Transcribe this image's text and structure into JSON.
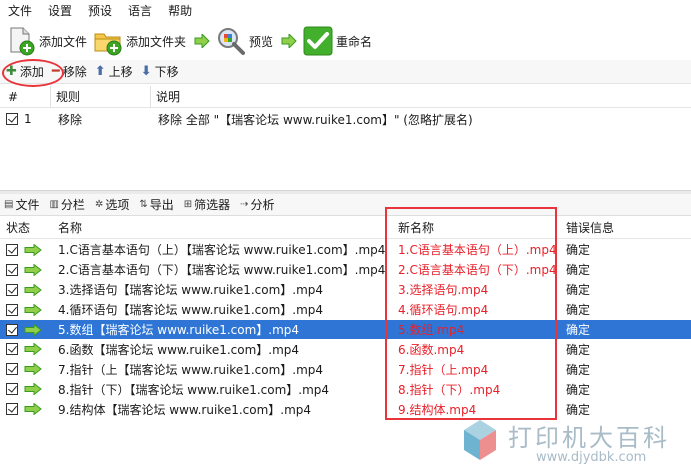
{
  "menubar": [
    "文件",
    "设置",
    "预设",
    "语言",
    "帮助"
  ],
  "toolbar": {
    "add_files": "添加文件",
    "add_folder": "添加文件夹",
    "preview": "预览",
    "rename": "重命名"
  },
  "rulebar": {
    "add": "添加",
    "remove": "移除",
    "up": "上移",
    "down": "下移"
  },
  "rule_table": {
    "headers": [
      "#",
      "规则",
      "说明"
    ],
    "rows": [
      {
        "num": "1",
        "rule": "移除",
        "desc": "移除 全部 \"【瑞客论坛 www.ruike1.com】\" (忽略扩展名)"
      }
    ]
  },
  "filebar": {
    "file": "文件",
    "columns": "分栏",
    "options": "选项",
    "export": "导出",
    "filter": "筛选器",
    "analyze": "分析"
  },
  "file_table": {
    "headers": [
      "状态",
      "名称",
      "新名称",
      "错误信息"
    ],
    "rows": [
      {
        "name": "1.C语言基本语句（上）【瑞客论坛 www.ruike1.com】.mp4",
        "new": "1.C语言基本语句（上）.mp4",
        "err": "确定"
      },
      {
        "name": "2.C语言基本语句（下）【瑞客论坛 www.ruike1.com】.mp4",
        "new": "2.C语言基本语句（下）.mp4",
        "err": "确定"
      },
      {
        "name": "3.选择语句【瑞客论坛 www.ruike1.com】.mp4",
        "new": "3.选择语句.mp4",
        "err": "确定"
      },
      {
        "name": "4.循环语句【瑞客论坛 www.ruike1.com】.mp4",
        "new": "4.循环语句.mp4",
        "err": "确定"
      },
      {
        "name": "5.数组【瑞客论坛 www.ruike1.com】.mp4",
        "new": "5.数组.mp4",
        "err": "确定"
      },
      {
        "name": "6.函数【瑞客论坛 www.ruike1.com】.mp4",
        "new": "6.函数.mp4",
        "err": "确定"
      },
      {
        "name": "7.指针（上【瑞客论坛 www.ruike1.com】.mp4",
        "new": "7.指针（上.mp4",
        "err": "确定"
      },
      {
        "name": "8.指针（下）【瑞客论坛 www.ruike1.com】.mp4",
        "new": "8.指针（下）.mp4",
        "err": "确定"
      },
      {
        "name": "9.结构体【瑞客论坛 www.ruike1.com】.mp4",
        "new": "9.结构体.mp4",
        "err": "确定"
      }
    ]
  },
  "watermark": {
    "text": "打印机大百科",
    "url": "www.djydbk.com"
  },
  "colors": {
    "selection": "#2e75d6",
    "new_name": "#e8202a",
    "annotation": "#e8343a",
    "arrow_green": "#3a9b22"
  },
  "icons": [
    "add-file-icon",
    "add-folder-icon",
    "preview-icon",
    "rename-check-icon",
    "green-arrow-icon"
  ]
}
